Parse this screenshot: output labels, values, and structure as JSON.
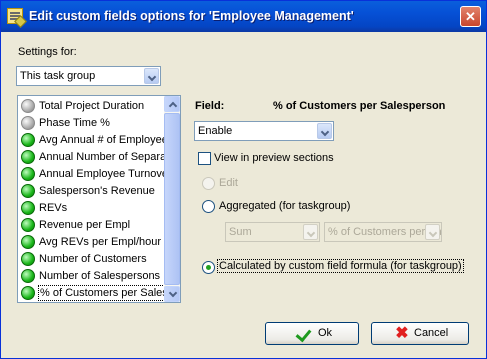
{
  "window": {
    "title": "Edit custom fields options for  'Employee Management'",
    "close_glyph": "✕"
  },
  "settings": {
    "label": "Settings for:",
    "value": "This task group"
  },
  "list": {
    "items": [
      {
        "label": "Total Project Duration",
        "status": "gray"
      },
      {
        "label": "Phase Time %",
        "status": "gray"
      },
      {
        "label": "Avg Annual # of Employees",
        "status": "green"
      },
      {
        "label": "Annual Number of  Separations",
        "status": "green"
      },
      {
        "label": "Annual Employee Turnover",
        "status": "green"
      },
      {
        "label": "Salesperson's Revenue",
        "status": "green"
      },
      {
        "label": "REVs",
        "status": "green"
      },
      {
        "label": "Revenue per Empl",
        "status": "green"
      },
      {
        "label": "Avg REVs per Empl/hour",
        "status": "green"
      },
      {
        "label": "Number of Customers",
        "status": "green"
      },
      {
        "label": "Number of Salespersons",
        "status": "green"
      },
      {
        "label": "% of Customers per Salesperson",
        "status": "green"
      }
    ],
    "selected_index": 11
  },
  "field": {
    "label": "Field:",
    "name": "% of Customers per Salesperson"
  },
  "enable_select": {
    "value": "Enable"
  },
  "view_preview": {
    "label": "View in preview sections",
    "checked": false
  },
  "options": {
    "edit": "Edit",
    "aggregated": "Aggregated (for taskgroup)",
    "aggregate_func": "Sum",
    "aggregate_field": "% of Customers per Sa",
    "calculated": "Calculated by custom field formula (for taskgroup)",
    "selected": "calculated"
  },
  "buttons": {
    "ok": "Ok",
    "cancel": "Cancel"
  },
  "colors": {
    "title_bar": "#0650d6",
    "dialog_bg": "#ece9d8",
    "status_green": "#19b619",
    "status_gray": "#a0a0a0"
  }
}
